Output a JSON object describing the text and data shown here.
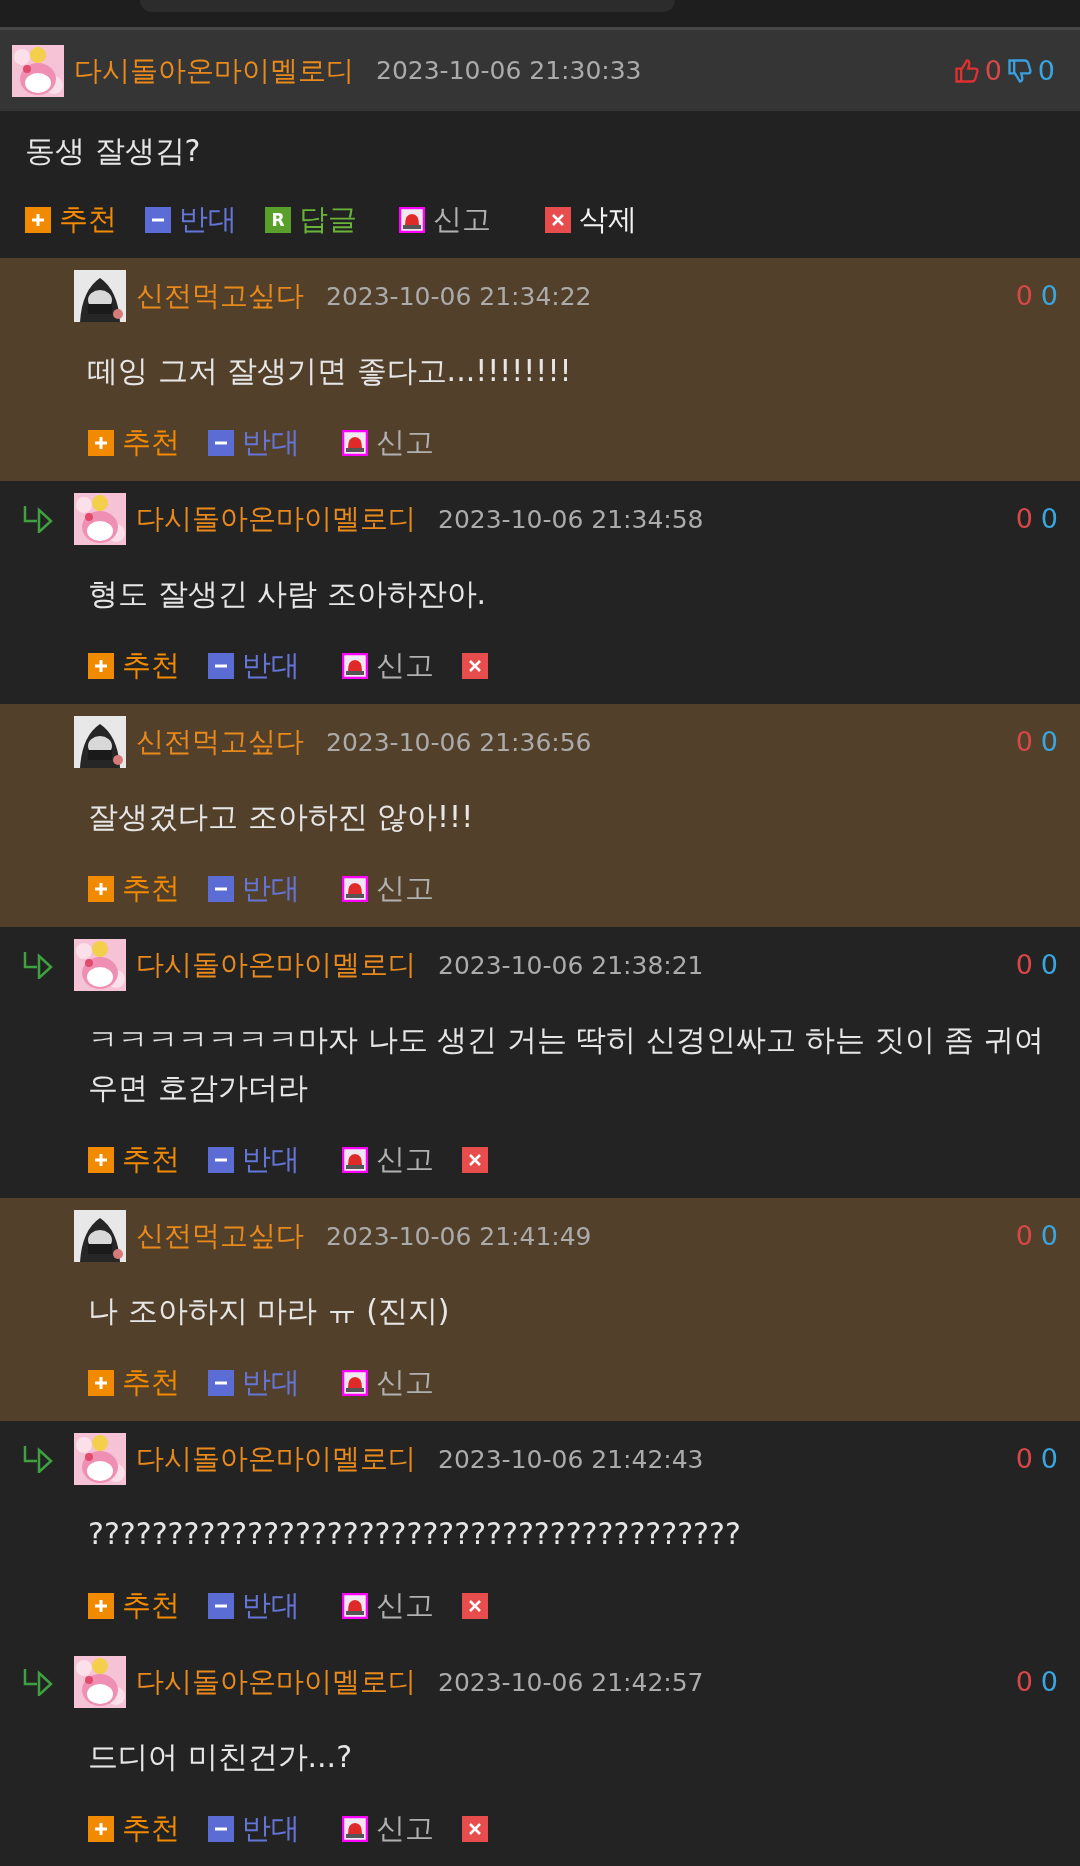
{
  "post": {
    "author": "다시돌아온마이멜로디",
    "avatar": {
      "kind": "pink"
    },
    "date": "2023-10-06 21:30:33",
    "likes": "0",
    "dislikes": "0",
    "message": "동생 잘생김?",
    "actions": [
      {
        "kind": "recommend",
        "label": "추천"
      },
      {
        "kind": "oppose",
        "label": "반대"
      },
      {
        "kind": "reply",
        "label": "답글",
        "badge": "R"
      },
      {
        "kind": "report",
        "label": "신고"
      },
      {
        "kind": "delete",
        "label": "삭제"
      }
    ]
  },
  "comments": [
    {
      "author": "신전먹고싶다",
      "avatar": {
        "kind": "dark"
      },
      "highlighted": true,
      "reply_arrow": false,
      "date": "2023-10-06 21:34:22",
      "likes": "0",
      "dislikes": "0",
      "message": "떼잉 그저 잘생기면 좋다고...!!!!!!!!",
      "actions": [
        {
          "kind": "recommend",
          "label": "추천"
        },
        {
          "kind": "oppose",
          "label": "반대"
        },
        {
          "kind": "report",
          "label": "신고"
        }
      ]
    },
    {
      "author": "다시돌아온마이멜로디",
      "avatar": {
        "kind": "pink"
      },
      "highlighted": false,
      "reply_arrow": true,
      "date": "2023-10-06 21:34:58",
      "likes": "0",
      "dislikes": "0",
      "message": "형도 잘생긴 사람 조아하잔아.",
      "actions": [
        {
          "kind": "recommend",
          "label": "추천"
        },
        {
          "kind": "oppose",
          "label": "반대"
        },
        {
          "kind": "report",
          "label": "신고"
        },
        {
          "kind": "delete"
        }
      ]
    },
    {
      "author": "신전먹고싶다",
      "avatar": {
        "kind": "dark"
      },
      "highlighted": true,
      "reply_arrow": false,
      "date": "2023-10-06 21:36:56",
      "likes": "0",
      "dislikes": "0",
      "message": "잘생겼다고 조아하진 않아!!!",
      "actions": [
        {
          "kind": "recommend",
          "label": "추천"
        },
        {
          "kind": "oppose",
          "label": "반대"
        },
        {
          "kind": "report",
          "label": "신고"
        }
      ]
    },
    {
      "author": "다시돌아온마이멜로디",
      "avatar": {
        "kind": "pink"
      },
      "highlighted": false,
      "reply_arrow": true,
      "date": "2023-10-06 21:38:21",
      "likes": "0",
      "dislikes": "0",
      "message": "ㅋㅋㅋㅋㅋㅋㅋ마자 나도 생긴 거는 딱히 신경인싸고 하는 짓이 좀 귀여우면 호감가더라",
      "actions": [
        {
          "kind": "recommend",
          "label": "추천"
        },
        {
          "kind": "oppose",
          "label": "반대"
        },
        {
          "kind": "report",
          "label": "신고"
        },
        {
          "kind": "delete"
        }
      ]
    },
    {
      "author": "신전먹고싶다",
      "avatar": {
        "kind": "dark"
      },
      "highlighted": true,
      "reply_arrow": false,
      "date": "2023-10-06 21:41:49",
      "likes": "0",
      "dislikes": "0",
      "message": "나 조아하지 마라 ㅠ (진지)",
      "actions": [
        {
          "kind": "recommend",
          "label": "추천"
        },
        {
          "kind": "oppose",
          "label": "반대"
        },
        {
          "kind": "report",
          "label": "신고"
        }
      ]
    },
    {
      "author": "다시돌아온마이멜로디",
      "avatar": {
        "kind": "pink"
      },
      "highlighted": false,
      "reply_arrow": true,
      "date": "2023-10-06 21:42:43",
      "likes": "0",
      "dislikes": "0",
      "message": "?????????????????????????????????????????",
      "actions": [
        {
          "kind": "recommend",
          "label": "추천"
        },
        {
          "kind": "oppose",
          "label": "반대"
        },
        {
          "kind": "report",
          "label": "신고"
        },
        {
          "kind": "delete"
        }
      ]
    },
    {
      "author": "다시돌아온마이멜로디",
      "avatar": {
        "kind": "pink"
      },
      "highlighted": false,
      "reply_arrow": true,
      "date": "2023-10-06 21:42:57",
      "likes": "0",
      "dislikes": "0",
      "message": "드디어 미친건가...?",
      "actions": [
        {
          "kind": "recommend",
          "label": "추천"
        },
        {
          "kind": "oppose",
          "label": "반대"
        },
        {
          "kind": "report",
          "label": "신고"
        },
        {
          "kind": "delete"
        }
      ]
    }
  ]
}
